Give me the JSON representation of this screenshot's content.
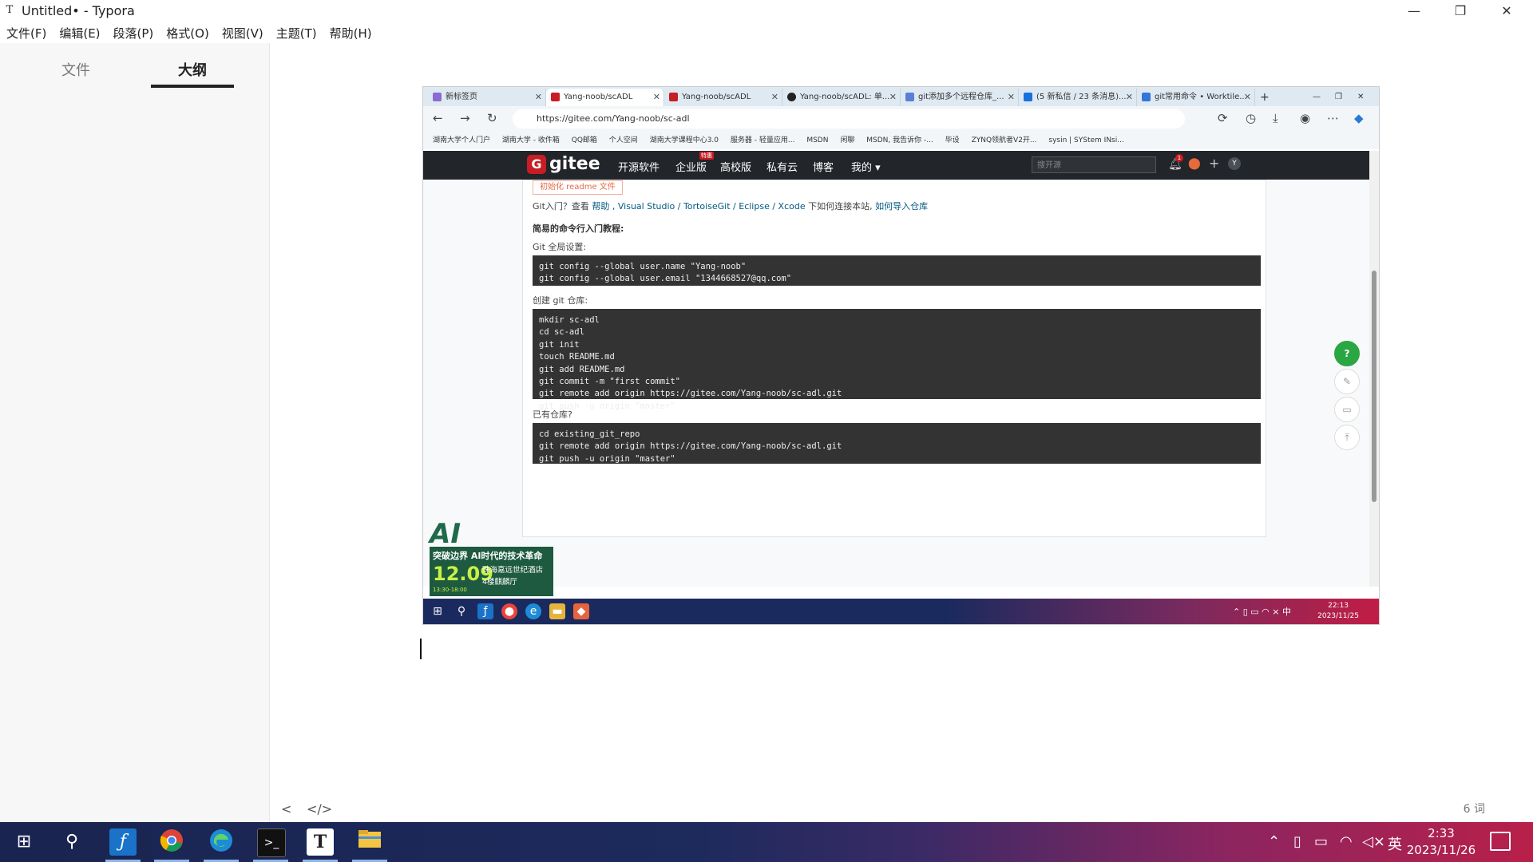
{
  "window": {
    "title": "Untitled• - Typora",
    "app_icon": "T"
  },
  "menu": [
    "文件(F)",
    "编辑(E)",
    "段落(P)",
    "格式(O)",
    "视图(V)",
    "主题(T)",
    "帮助(H)"
  ],
  "sidebar": {
    "tabs": [
      "文件",
      "大纲"
    ],
    "active_tab": "大纲",
    "footer_left": "<",
    "footer_source": "</>"
  },
  "status": {
    "word_count": "6 词"
  },
  "screenshot": {
    "browser_tabs": [
      {
        "label": "新标签页",
        "color": "#8a6bd1"
      },
      {
        "label": "Yang-noob/scADL",
        "color": "#c71d23"
      },
      {
        "label": "Yang-noob/scADL",
        "color": "#c71d23"
      },
      {
        "label": "Yang-noob/scADL: 单...",
        "color": "#222222"
      },
      {
        "label": "git添加多个远程仓库_...",
        "color": "#5a7fd6"
      },
      {
        "label": "(5 新私信 / 23 条消息)...",
        "color": "#1670e0"
      },
      {
        "label": "git常用命令 • Worktile...",
        "color": "#3375d8"
      }
    ],
    "url": "https://gitee.com/Yang-noob/sc-adl",
    "bookmarks": [
      "湖南大学个人门户",
      "湖南大学 - 收件箱",
      "QQ邮箱",
      "个人空间",
      "湖南大学课程中心3.0",
      "服务器 - 轻量应用...",
      "MSDN",
      "闲聊",
      "MSDN, 我告诉你 -...",
      "毕设",
      "ZYNQ领航者V2开...",
      "sysin | SYStem INsi..."
    ],
    "gitee": {
      "logo": "gitee",
      "nav": [
        "开源软件",
        "企业版",
        "高校版",
        "私有云",
        "博客",
        "我的 ▾"
      ],
      "badge": "特惠",
      "search_placeholder": "搜开源",
      "notif_count": "1",
      "avatar": "Y"
    },
    "readme_btn": "初始化 readme 文件",
    "intro": {
      "prefix": "Git入门？查看 ",
      "links": "帮助 , Visual Studio / TortoiseGit / Eclipse / Xcode",
      "middle": " 下如何连接本站, ",
      "link2": "如何导入仓库"
    },
    "heading": "简易的命令行入门教程:",
    "section1": "Git 全局设置:",
    "code1": "git config --global user.name \"Yang-noob\"\ngit config --global user.email \"1344668527@qq.com\"",
    "section2": "创建 git 仓库:",
    "code2": "mkdir sc-adl\ncd sc-adl\ngit init\ntouch README.md\ngit add README.md\ngit commit -m \"first commit\"\ngit remote add origin https://gitee.com/Yang-noob/sc-adl.git\ngit push -u origin \"master\"",
    "section3": "已有仓库?",
    "code3": "cd existing_git_repo\ngit remote add origin https://gitee.com/Yang-noob/sc-adl.git\ngit push -u origin \"master\"",
    "ad": {
      "title": "AI",
      "line1": "突破边界 AI时代的技术革命",
      "date": "12.09",
      "venue": "珠海嘉远世纪酒店\n4楼麒麟厅",
      "time": "13:30-18:00"
    },
    "taskbar": {
      "tray": "⌃ ▯ ▭ ◠ ×  中",
      "time": "22:13",
      "date": "2023/11/25"
    }
  },
  "taskbar": {
    "tray_ime": "英",
    "time": "2:33",
    "date": "2023/11/26"
  }
}
